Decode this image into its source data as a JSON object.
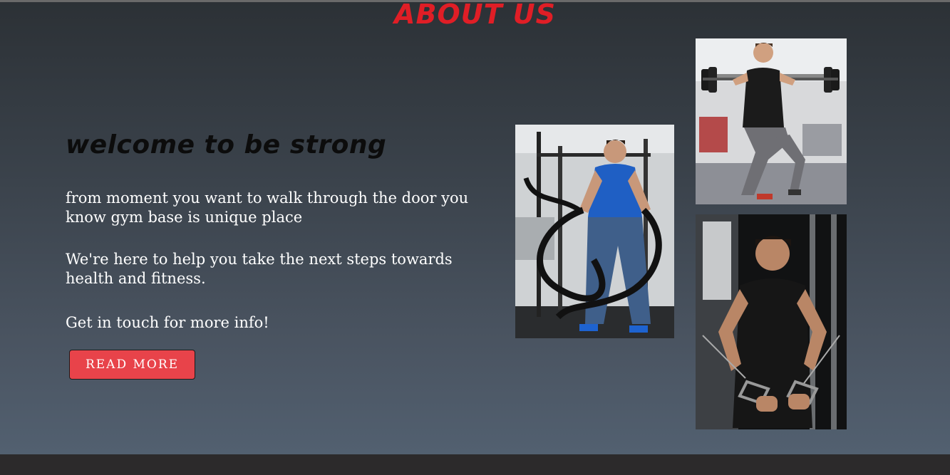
{
  "section": {
    "title": "ABOUT US",
    "heading": "welcome to be strong",
    "paragraphs": [
      "from moment you want to walk through the door you know gym base is unique place",
      "We're here to help you take the next steps towards health and fitness.",
      "Get in touch for more info!"
    ],
    "button_label": "READ MORE"
  },
  "images": [
    {
      "name": "battle-ropes-photo"
    },
    {
      "name": "barbell-lunge-photo"
    },
    {
      "name": "cable-crossover-photo"
    }
  ],
  "colors": {
    "title": "#e01e26",
    "button": "#e8434a",
    "text": "#ffffff",
    "heading": "#0c0c0c"
  }
}
